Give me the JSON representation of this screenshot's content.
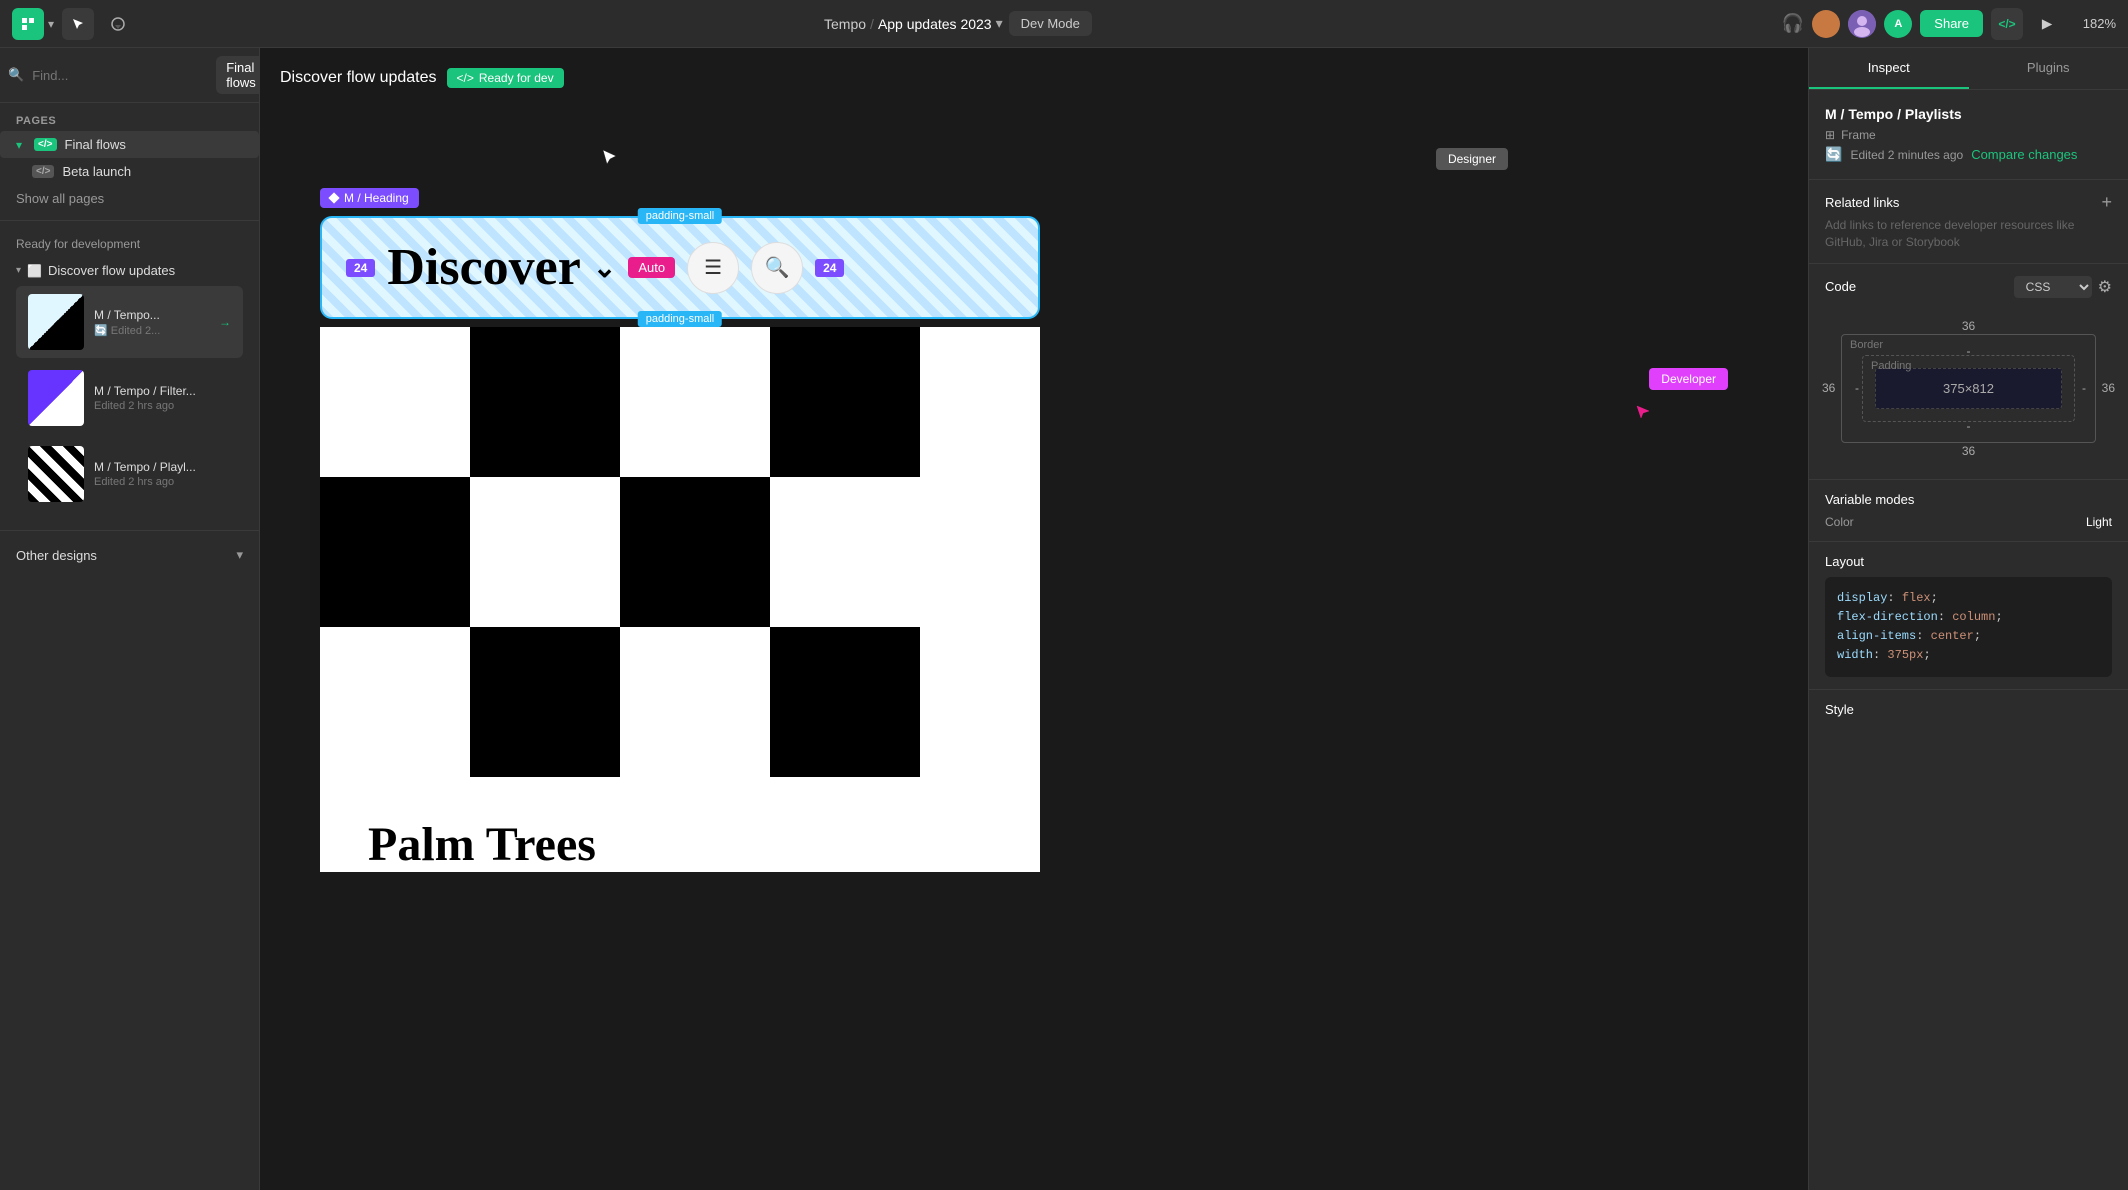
{
  "topbar": {
    "logo": "F",
    "breadcrumb": {
      "workspace": "Tempo",
      "separator": "/",
      "file": "App updates 2023",
      "chevron": "▾"
    },
    "dev_mode": "Dev Mode",
    "zoom": "182%",
    "share_label": "Share",
    "tabs": {
      "inspect": "Inspect",
      "plugins": "Plugins"
    }
  },
  "sidebar": {
    "search_placeholder": "Find...",
    "page_selector": "Final flows",
    "pages_section_title": "Pages",
    "pages": [
      {
        "id": "final-flows",
        "label": "Final flows",
        "icon": "</>",
        "active": true
      },
      {
        "id": "beta-launch",
        "label": "Beta launch",
        "icon": "</>"
      }
    ],
    "show_all": "Show all pages",
    "ready_section_title": "Ready for development",
    "frame_group": "Discover flow updates",
    "frames": [
      {
        "id": "frame-1",
        "name": "M / Tempo...",
        "time": "Edited 2...",
        "active": true
      },
      {
        "id": "frame-2",
        "name": "M / Tempo / Filter...",
        "time": "Edited 2 hrs ago"
      },
      {
        "id": "frame-3",
        "name": "M / Tempo / Playl...",
        "time": "Edited 2 hrs ago"
      }
    ],
    "other_designs": "Other designs"
  },
  "canvas": {
    "title": "Discover flow updates",
    "ready_badge": "Ready for dev",
    "ready_badge_icon": "</>",
    "heading_annotation": "M / Heading",
    "designer_label": "Designer",
    "developer_label": "Developer",
    "padding_small": "padding-small",
    "spacing_24": "24",
    "auto_badge": "Auto",
    "discover_text": "Discover",
    "chevron": "⌄",
    "palm_trees": "Palm Trees"
  },
  "right_panel": {
    "tabs": [
      "Inspect",
      "Plugins"
    ],
    "active_tab": "Inspect",
    "component_path": "M / Tempo / Playlists",
    "frame_type": "Frame",
    "edit_time": "Edited 2 minutes ago",
    "compare_changes": "Compare changes",
    "related_links_title": "Related links",
    "related_links_desc": "Add links to reference developer resources like GitHub, Jira or Storybook",
    "code_section_title": "Code",
    "code_lang": "CSS",
    "box_model": {
      "outer_top": "36",
      "outer_bottom": "36",
      "outer_left": "36",
      "outer_right": "36",
      "border_label": "Border",
      "padding_label": "Padding",
      "inner_top": "-",
      "inner_bottom": "-",
      "inner_left": "-",
      "inner_right": "-",
      "dimensions": "375×812"
    },
    "variable_modes_title": "Variable modes",
    "color_label": "Color",
    "color_value": "Light",
    "layout_title": "Layout",
    "code_lines": [
      {
        "prop": "display",
        "val": "flex"
      },
      {
        "prop": "flex-direction",
        "val": "column"
      },
      {
        "prop": "align-items",
        "val": "center"
      },
      {
        "prop": "width",
        "val": "375px"
      }
    ],
    "style_title": "Style"
  }
}
